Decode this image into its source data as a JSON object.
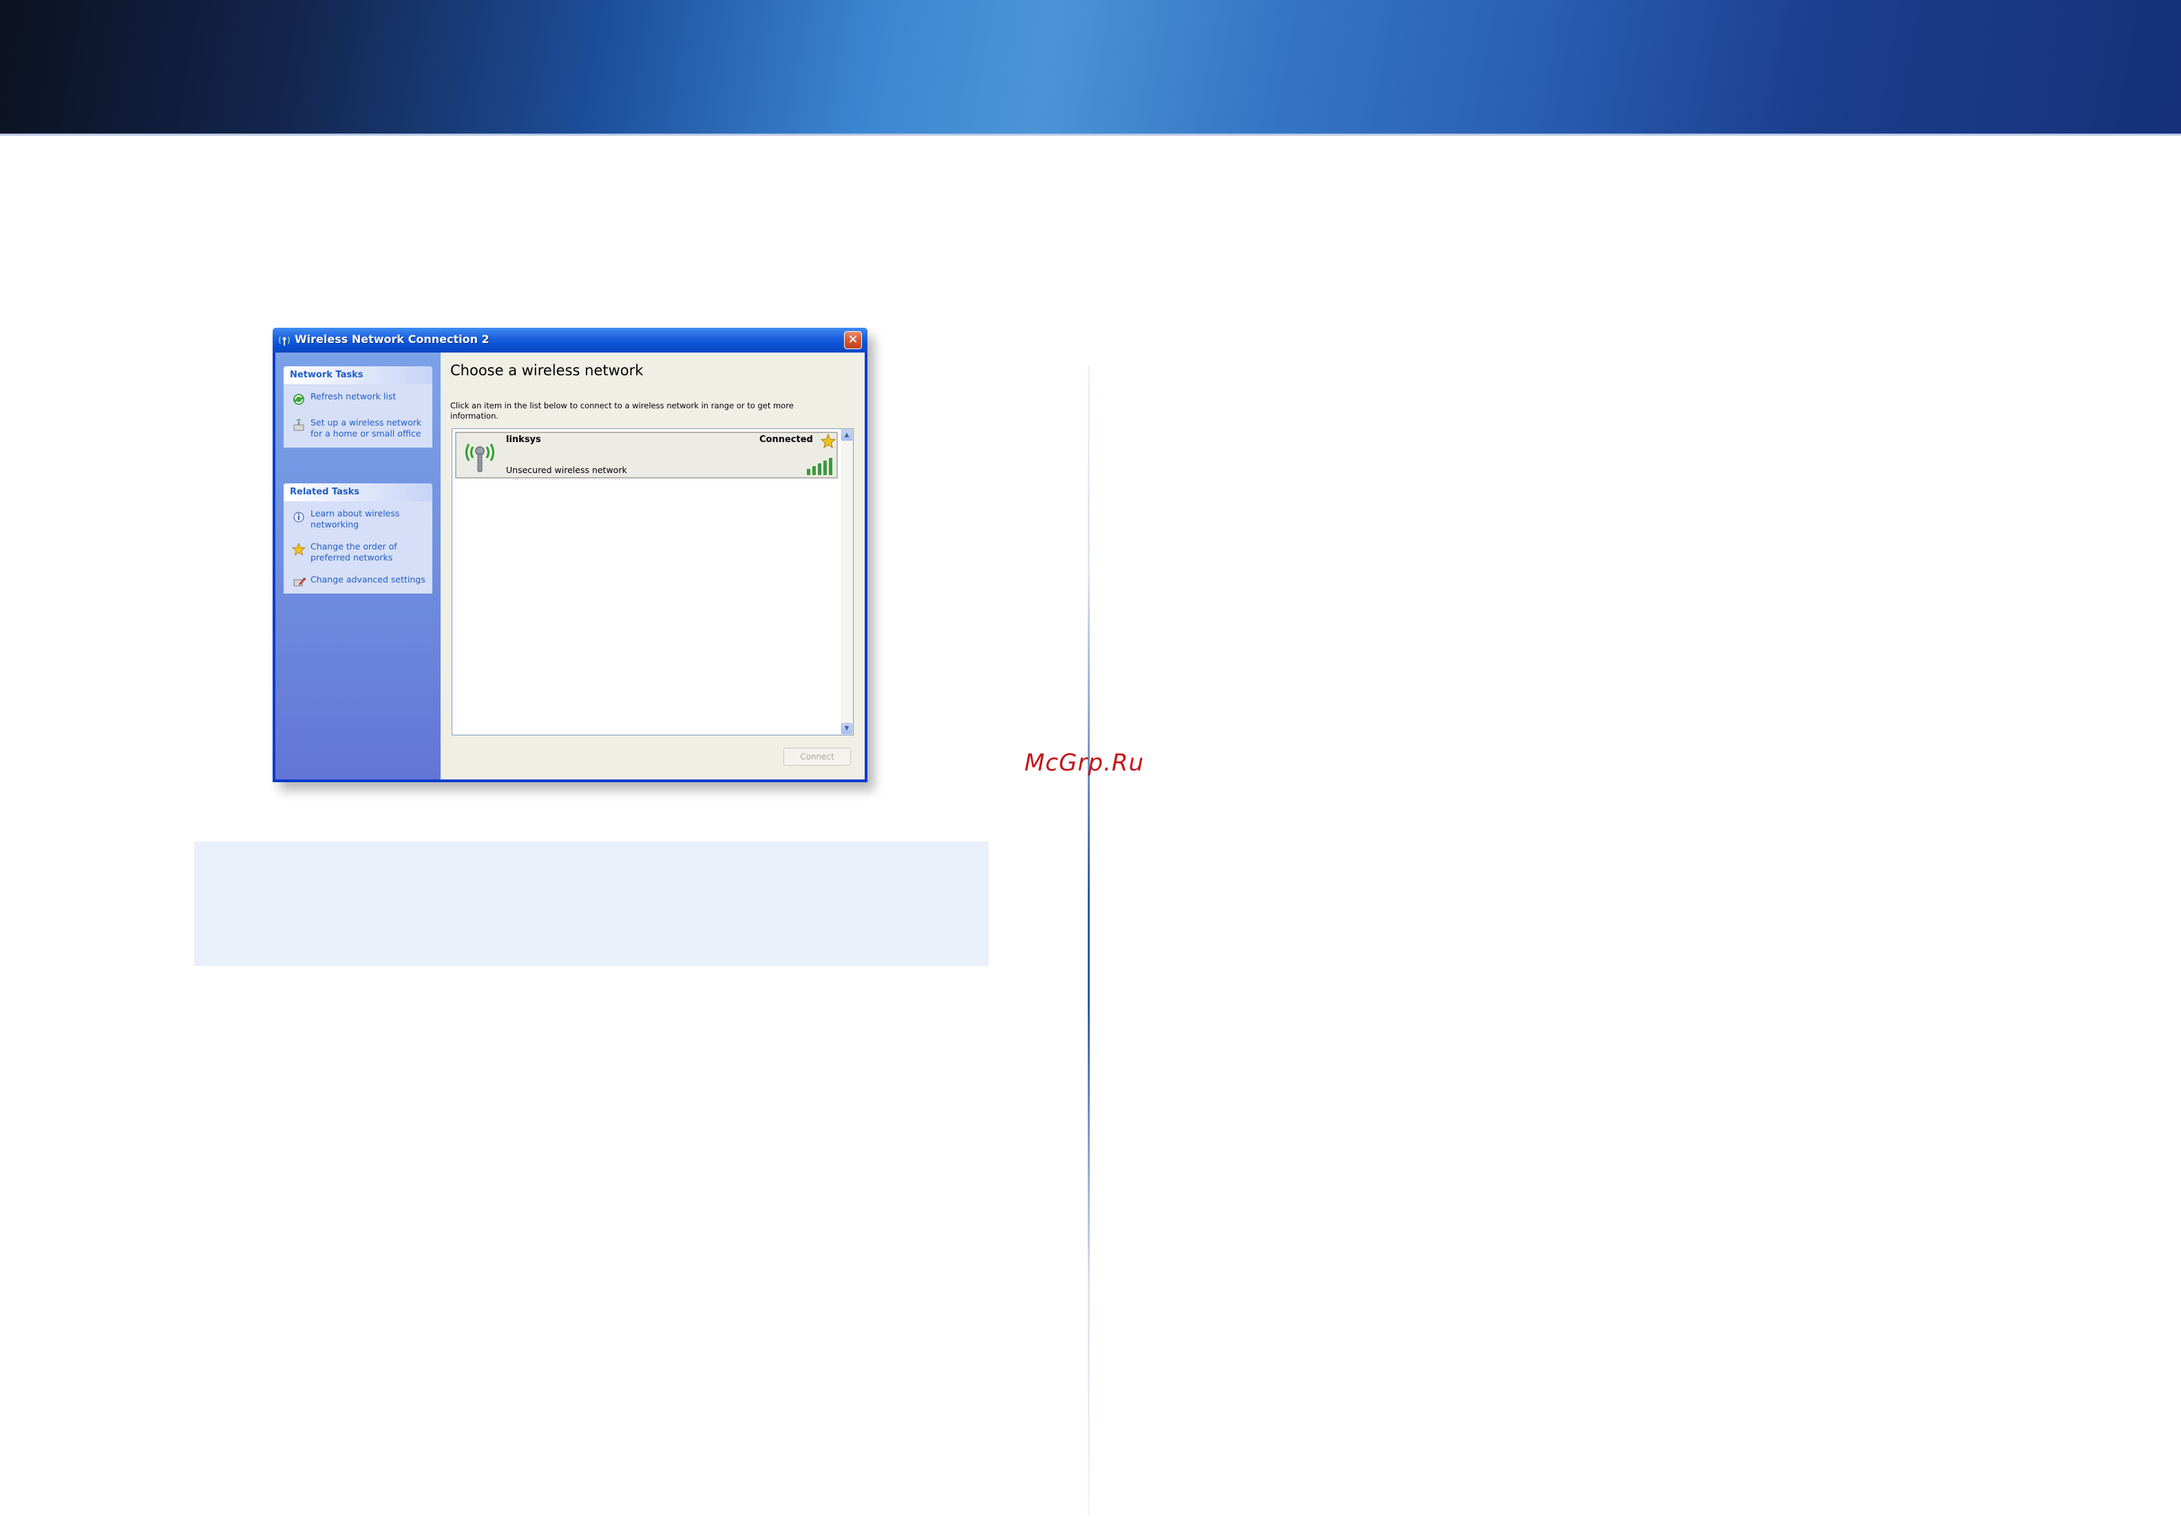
{
  "watermark": "McGrp.Ru",
  "dialog": {
    "title": "Wireless Network Connection 2",
    "close_symbol": "×",
    "network_tasks": {
      "header": "Network Tasks",
      "items": [
        {
          "label": "Refresh network list",
          "icon": "refresh-icon"
        },
        {
          "label": "Set up a wireless network for a home or small office",
          "icon": "setup-network-icon"
        }
      ]
    },
    "related_tasks": {
      "header": "Related Tasks",
      "items": [
        {
          "label": "Learn about wireless networking",
          "icon": "info-icon"
        },
        {
          "label": "Change the order of preferred networks",
          "icon": "star-icon"
        },
        {
          "label": "Change advanced settings",
          "icon": "settings-icon"
        }
      ]
    },
    "heading": "Choose a wireless network",
    "instructions": "Click an item in the list below to connect to a wireless network in range or to get more information.",
    "networks": [
      {
        "ssid": "linksys",
        "status": "Connected",
        "security": "Unsecured wireless network",
        "signal_bars": 5,
        "preferred": true
      }
    ],
    "connect_button": "Connect",
    "scroll_up": "▲",
    "scroll_down": "▼"
  },
  "colors": {
    "title_blue": "#0a46c4",
    "task_link": "#215dc6",
    "signal_green": "#3c9a3c",
    "star_gold": "#f1c21b",
    "divider_blue": "#2f5aa8",
    "watermark_red": "#c3171b"
  }
}
